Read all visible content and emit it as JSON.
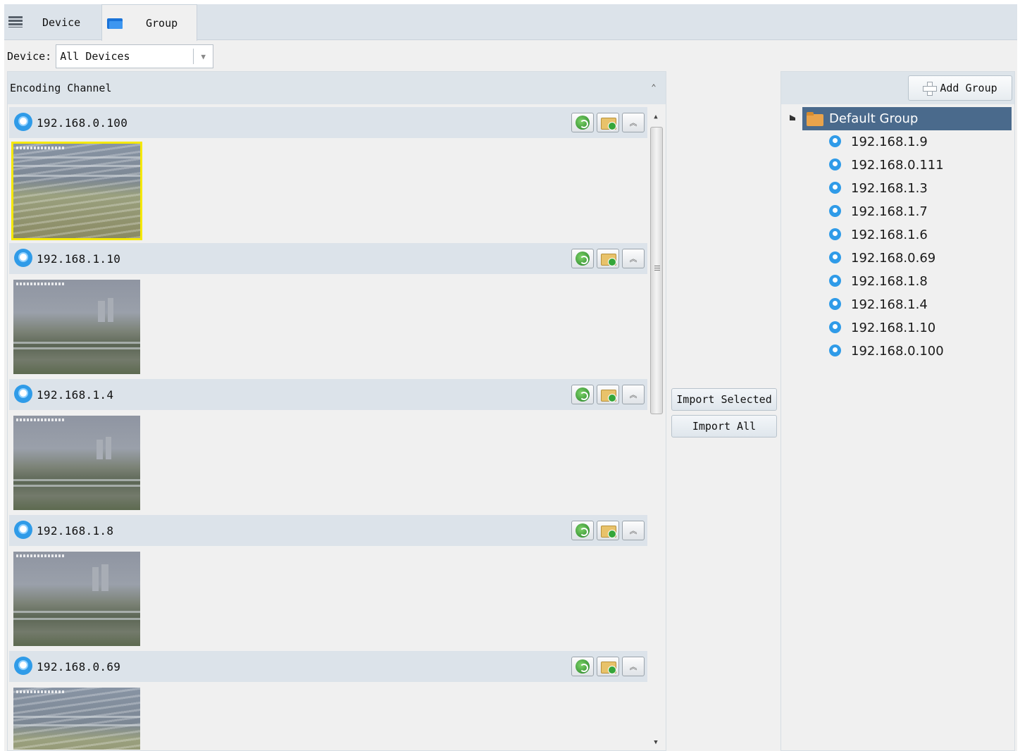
{
  "tabs": [
    {
      "label": "Device",
      "icon": "device-list-icon"
    },
    {
      "label": "Group",
      "icon": "folder-icon"
    }
  ],
  "filter": {
    "label": "Device:",
    "value": "All Devices"
  },
  "encoding_panel": {
    "title": "Encoding Channel",
    "channels": [
      {
        "ip": "192.168.0.100",
        "selected": true
      },
      {
        "ip": "192.168.1.10",
        "selected": false
      },
      {
        "ip": "192.168.1.4",
        "selected": false
      },
      {
        "ip": "192.168.1.8",
        "selected": false
      },
      {
        "ip": "192.168.0.69",
        "selected": false
      }
    ]
  },
  "actions": {
    "import_selected": "Import Selected",
    "import_all": "Import All"
  },
  "group_panel": {
    "add_group_label": "Add Group",
    "root": "Default Group",
    "devices": [
      "192.168.1.9",
      "192.168.0.111",
      "192.168.1.3",
      "192.168.1.7",
      "192.168.1.6",
      "192.168.0.69",
      "192.168.1.8",
      "192.168.1.4",
      "192.168.1.10",
      "192.168.0.100"
    ]
  },
  "colors": {
    "selected_row": "#4a6a8c",
    "accent": "#2f9be8",
    "selected_thumb": "#f5e800"
  }
}
